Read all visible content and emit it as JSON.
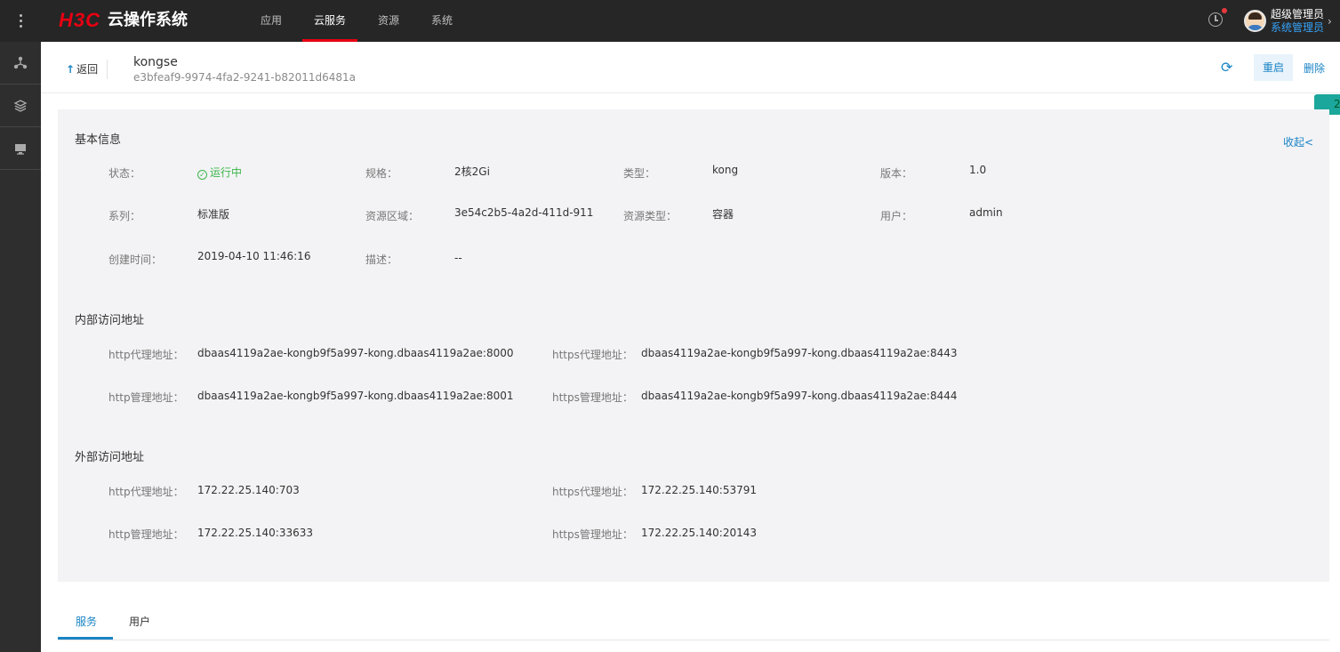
{
  "brand": {
    "logo_mark": "H3C",
    "os_title": "云操作系统"
  },
  "nav": [
    {
      "label": "应用",
      "active": false
    },
    {
      "label": "云服务",
      "active": true
    },
    {
      "label": "资源",
      "active": false
    },
    {
      "label": "系统",
      "active": false
    }
  ],
  "user": {
    "name": "超级管理员",
    "role": "系统管理员"
  },
  "header": {
    "back_label": "返回",
    "instance_name": "kongse",
    "instance_id": "e3bfeaf9-9974-4fa2-9241-b82011d6481a",
    "restart_label": "重启",
    "delete_label": "删除",
    "side_tab_text": "2"
  },
  "basic_info": {
    "title": "基本信息",
    "collapse_label": "收起<",
    "fields": {
      "status": {
        "label": "状态：",
        "value": "运行中"
      },
      "spec": {
        "label": "规格：",
        "value": "2核2Gi"
      },
      "type": {
        "label": "类型：",
        "value": "kong"
      },
      "version": {
        "label": "版本：",
        "value": "1.0"
      },
      "series": {
        "label": "系列：",
        "value": "标准版"
      },
      "zone": {
        "label": "资源区域：",
        "value": "3e54c2b5-4a2d-411d-911"
      },
      "resource_type": {
        "label": "资源类型：",
        "value": "容器"
      },
      "user": {
        "label": "用户：",
        "value": "admin"
      },
      "created": {
        "label": "创建时间：",
        "value": "2019-04-10 11:46:16"
      },
      "description": {
        "label": "描述：",
        "value": "--"
      }
    }
  },
  "internal": {
    "title": "内部访问地址",
    "http_proxy": {
      "label": "http代理地址：",
      "value": "dbaas4119a2ae-kongb9f5a997-kong.dbaas4119a2ae:8000"
    },
    "https_proxy": {
      "label": "https代理地址：",
      "value": "dbaas4119a2ae-kongb9f5a997-kong.dbaas4119a2ae:8443"
    },
    "http_admin": {
      "label": "http管理地址：",
      "value": "dbaas4119a2ae-kongb9f5a997-kong.dbaas4119a2ae:8001"
    },
    "https_admin": {
      "label": "https管理地址：",
      "value": "dbaas4119a2ae-kongb9f5a997-kong.dbaas4119a2ae:8444"
    }
  },
  "external": {
    "title": "外部访问地址",
    "http_proxy": {
      "label": "http代理地址：",
      "value": "172.22.25.140:703"
    },
    "https_proxy": {
      "label": "https代理地址：",
      "value": "172.22.25.140:53791"
    },
    "http_admin": {
      "label": "http管理地址：",
      "value": "172.22.25.140:33633"
    },
    "https_admin": {
      "label": "https管理地址：",
      "value": "172.22.25.140:20143"
    }
  },
  "tabs": [
    {
      "label": "服务",
      "active": true
    },
    {
      "label": "用户",
      "active": false
    }
  ],
  "colors": {
    "accent": "#1a84c6",
    "brand_red": "#e60012",
    "status_green": "#3bb64a",
    "topbar": "#262626"
  }
}
